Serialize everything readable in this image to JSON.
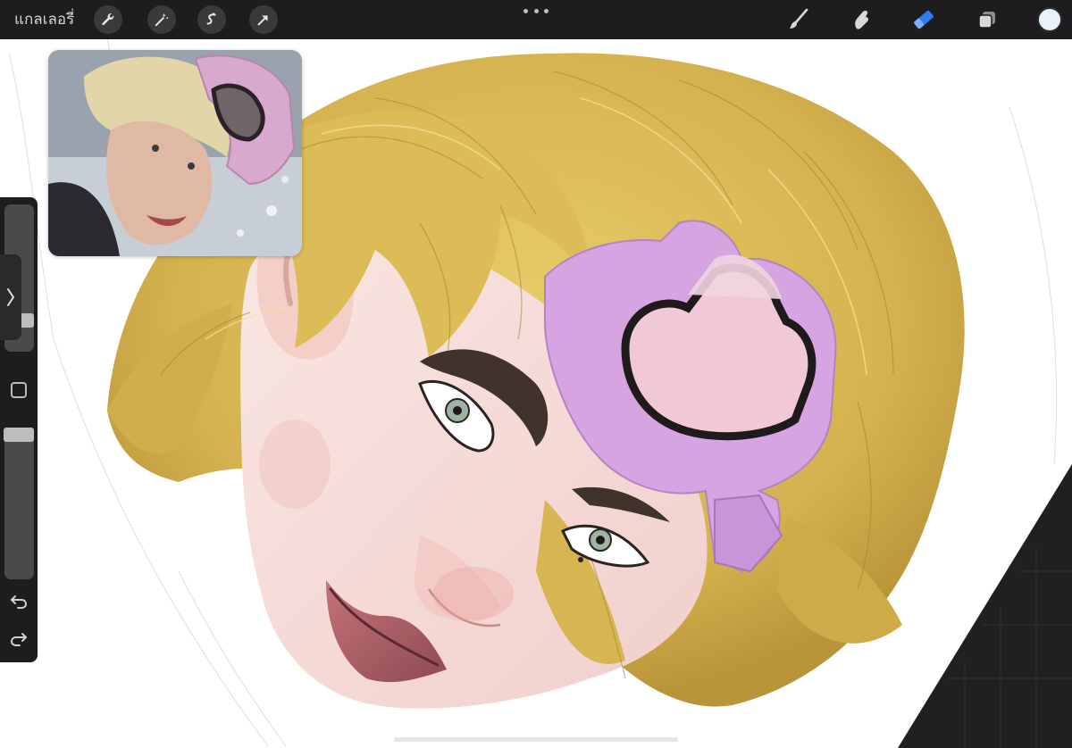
{
  "toolbar": {
    "gallery_label": "แกลเลอรี่",
    "left_tools": [
      "wrench-icon",
      "magic-wand-icon",
      "selection-icon",
      "transform-arrow-icon"
    ],
    "right_tools": [
      "brush-icon",
      "smudge-icon",
      "eraser-icon",
      "layers-icon"
    ],
    "active_tool": "eraser-icon",
    "active_color": "#e7f1f8",
    "accent": "#2f7bf5"
  },
  "sidebar": {
    "brush_size_level": 0.18,
    "opacity_level": 0.02,
    "buttons": [
      "modify-icon",
      "undo-icon",
      "redo-icon"
    ]
  },
  "colors": {
    "hair": "#d9b751",
    "headband": "#d7a4e2",
    "skin": "#f6ddd9",
    "lips": "#b86870"
  }
}
